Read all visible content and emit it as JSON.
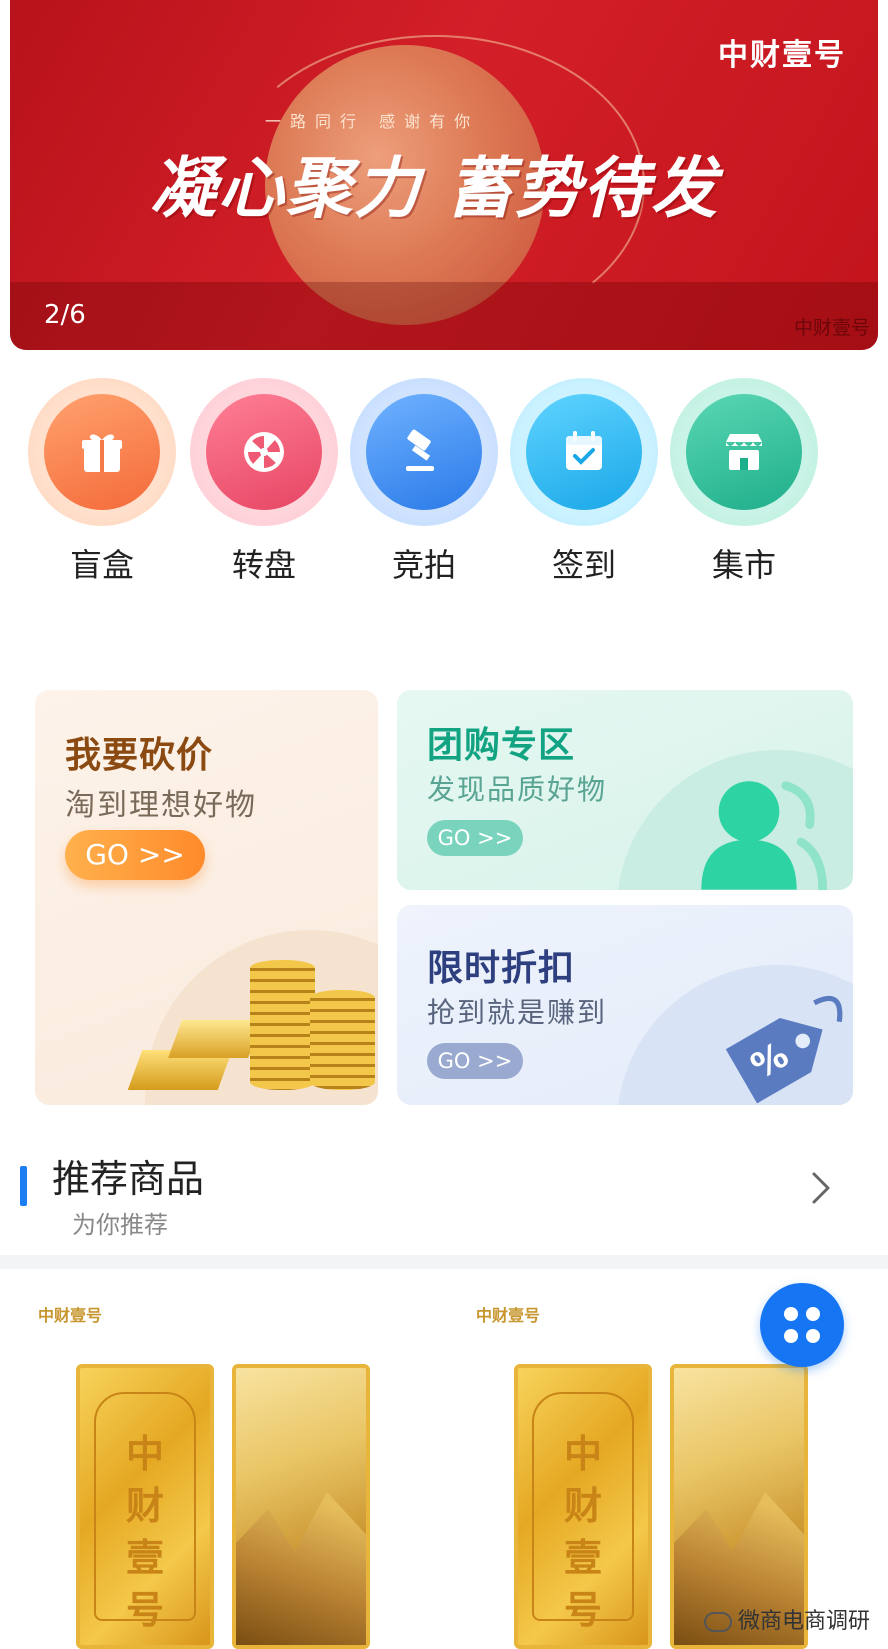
{
  "banner": {
    "brand": "中财壹号",
    "tagline": "一路同行 感谢有你",
    "headline": "凝心聚力 蓄势待发",
    "counter": "2/6",
    "brand_small": "中财壹号"
  },
  "nav": {
    "items": [
      {
        "label": "盲盒",
        "icon": "gift-icon"
      },
      {
        "label": "转盘",
        "icon": "wheel-icon"
      },
      {
        "label": "竞拍",
        "icon": "gavel-icon"
      },
      {
        "label": "签到",
        "icon": "calendar-check-icon"
      },
      {
        "label": "集市",
        "icon": "store-icon"
      }
    ]
  },
  "promos": {
    "bargain": {
      "title": "我要砍价",
      "subtitle": "淘到理想好物",
      "go": "GO >>"
    },
    "group": {
      "title": "团购专区",
      "subtitle": "发现品质好物",
      "go": "GO >>"
    },
    "discount": {
      "title": "限时折扣",
      "subtitle": "抢到就是赚到",
      "go": "GO >>"
    }
  },
  "section": {
    "title": "推荐商品",
    "subtitle": "为你推荐"
  },
  "products": [
    {
      "brand": "中财壹号",
      "bar_text": "中财壹号"
    },
    {
      "brand": "中财壹号",
      "bar_text": "中财壹号"
    }
  ],
  "watermark": "微商电商调研",
  "colors": {
    "accent": "#1575f2",
    "banner_red": "#c8151e",
    "bargain_title": "#8a4a12",
    "group_title": "#12a383",
    "discount_title": "#2d3f7e"
  }
}
